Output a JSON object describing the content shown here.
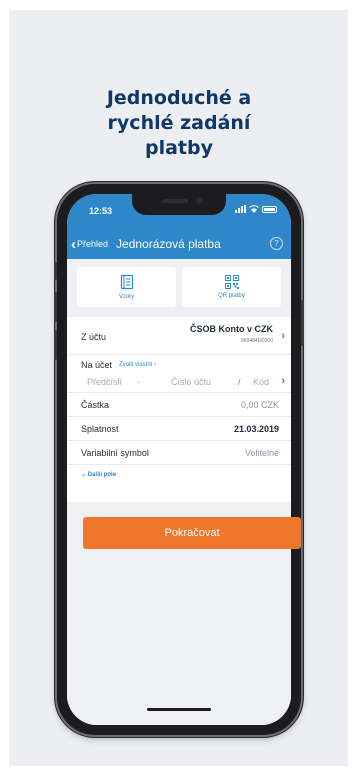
{
  "headline": "Jednoduché a rychlé zadání platby",
  "status": {
    "time": "12:53"
  },
  "nav": {
    "back_label": "Přehled",
    "title": "Jednorázová platba",
    "help": "?"
  },
  "tiles": [
    {
      "label": "Vzory",
      "icon": "template-book-icon"
    },
    {
      "label": "QR platby",
      "icon": "qr-code-icon"
    }
  ],
  "from_account": {
    "label": "Z účtu",
    "name": "ČSOB Konto v CZK",
    "number": "9694846/0300"
  },
  "to_account": {
    "label": "Na účet",
    "choose_own": "Zvolit vlastní",
    "prefix_placeholder": "Předčíslí",
    "separator": "-",
    "account_placeholder": "Číslo účtu",
    "slash": "/",
    "bank_placeholder": "Kód"
  },
  "amount": {
    "label": "Částka",
    "value": "0,00",
    "currency": "CZK"
  },
  "due_date": {
    "label": "Splatnost",
    "value": "21.03.2019"
  },
  "variable_symbol": {
    "label": "Variabilní symbol",
    "placeholder": "Volitelné"
  },
  "more_fields": "Další pole",
  "continue_button": "Pokračovat",
  "colors": {
    "primary": "#2d87c8",
    "accent": "#f0762c",
    "headline": "#0f3868"
  }
}
